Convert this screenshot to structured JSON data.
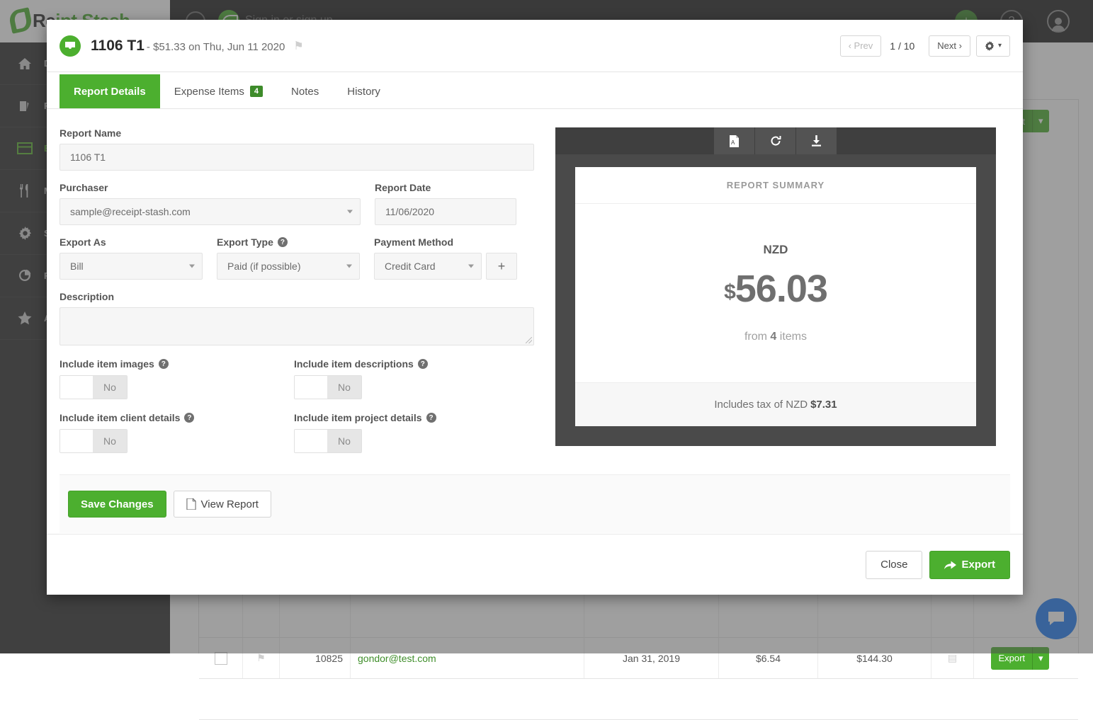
{
  "background": {
    "logo_text_dark": "Re",
    "logo_text_green": "ipt Stash",
    "brand_label": "Sign in or sign up",
    "sidebar_items": [
      {
        "label": "DA",
        "icon": "home-icon"
      },
      {
        "label": "RE",
        "icon": "receipts-icon"
      },
      {
        "label": "EX",
        "icon": "credit-card-icon"
      },
      {
        "label": "MI",
        "icon": "meals-icon"
      },
      {
        "label": "SE",
        "icon": "gear-icon"
      },
      {
        "label": "RE",
        "icon": "pie-chart-icon"
      },
      {
        "label": "AC",
        "icon": "star-icon"
      }
    ],
    "table_row": {
      "number": "10825",
      "email": "gondor@test.com",
      "date": "Jan 31, 2019",
      "tax": "$6.54",
      "total": "$144.30",
      "export_label": "Export"
    }
  },
  "modal": {
    "title": "1106 T1",
    "subtitle": "- $51.33 on Thu, Jun 11 2020",
    "title_icon": "inbox-icon",
    "flag_icon": "flag-icon",
    "nav": {
      "prev_label": "‹ Prev",
      "page_indicator": "1 / 10",
      "next_label": "Next ›",
      "gear_icon": "gear-icon"
    },
    "tabs": [
      {
        "label": "Report Details",
        "badge": "",
        "active": true
      },
      {
        "label": "Expense Items",
        "badge": "4",
        "active": false
      },
      {
        "label": "Notes",
        "badge": "",
        "active": false
      },
      {
        "label": "History",
        "badge": "",
        "active": false
      }
    ],
    "form": {
      "report_name_label": "Report Name",
      "report_name_value": "1106 T1",
      "purchaser_label": "Purchaser",
      "purchaser_value": "sample@receipt-stash.com",
      "report_date_label": "Report Date",
      "report_date_value": "11/06/2020",
      "export_as_label": "Export As",
      "export_as_value": "Bill",
      "export_type_label": "Export Type",
      "export_type_value": "Paid (if possible)",
      "payment_method_label": "Payment Method",
      "payment_method_value": "Credit Card",
      "add_payment_icon": "plus-icon",
      "description_label": "Description",
      "description_value": "",
      "toggles": [
        {
          "label": "Include item images",
          "state": "No"
        },
        {
          "label": "Include item descriptions",
          "state": "No"
        },
        {
          "label": "Include item client details",
          "state": "No"
        },
        {
          "label": "Include item project details",
          "state": "No"
        }
      ]
    },
    "preview": {
      "toolbar_icons": [
        "pdf-file-icon",
        "refresh-icon",
        "download-icon"
      ],
      "header": "REPORT SUMMARY",
      "currency": "NZD",
      "currency_symbol": "$",
      "amount": "56.03",
      "items_prefix": "from",
      "items_count": "4",
      "items_suffix": "items",
      "tax_prefix": "Includes tax of NZD",
      "tax_amount": "$7.31"
    },
    "actions": {
      "save_label": "Save Changes",
      "view_report_label": "View Report",
      "view_report_icon": "pdf-file-icon"
    },
    "footer": {
      "close_label": "Close",
      "export_label": "Export",
      "export_icon": "share-arrow-icon"
    }
  },
  "colors": {
    "accent_green": "#4caf2f",
    "dark_sidebar": "#2d2d2d",
    "topbar": "#1f1f1f",
    "chat_blue": "#1d7af3"
  }
}
